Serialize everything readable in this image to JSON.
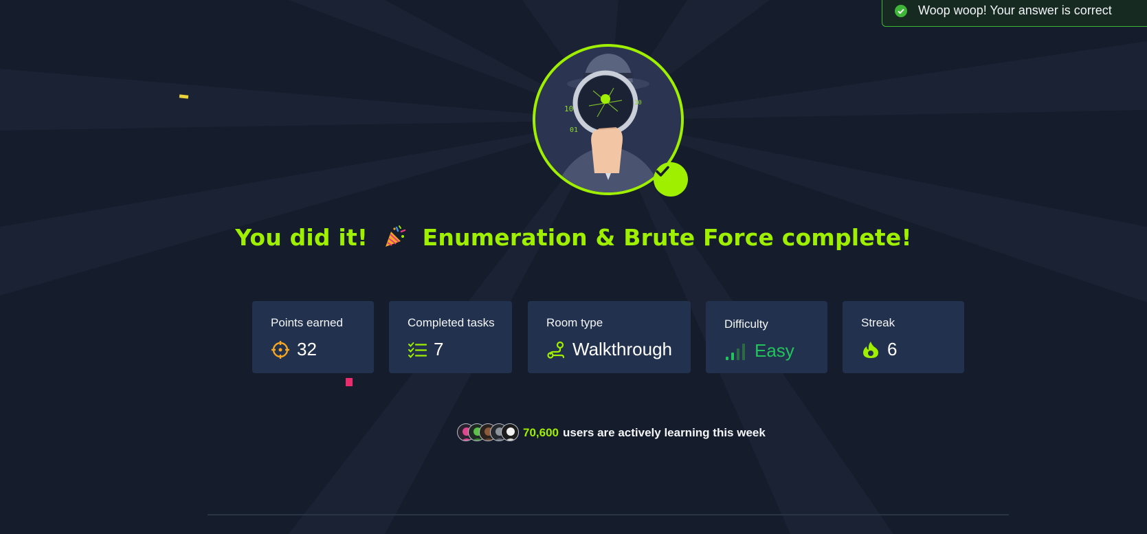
{
  "toast": {
    "message": "Woop woop! Your answer is correct",
    "color": "#3fb638"
  },
  "headline": {
    "before": "You did it!",
    "emoji": "party-popper",
    "after": "Enumeration & Brute Force complete!",
    "color": "#9fef00"
  },
  "stats": [
    {
      "label": "Points earned",
      "icon": "crosshair-icon",
      "value": "32"
    },
    {
      "label": "Completed tasks",
      "icon": "checklist-icon",
      "value": "7"
    },
    {
      "label": "Room type",
      "icon": "route-icon",
      "value": "Walkthrough"
    },
    {
      "label": "Difficulty",
      "icon": "signal-bars-icon",
      "value": "Easy"
    },
    {
      "label": "Streak",
      "icon": "flame-icon",
      "value": "6"
    }
  ],
  "community": {
    "count": "70,600",
    "text": "users are actively learning this week",
    "avatars": [
      "avatar-pink",
      "avatar-green",
      "avatar-brown",
      "avatar-gray",
      "avatar-white"
    ]
  },
  "colors": {
    "background": "#151c2b",
    "card": "#22314d",
    "accent": "#9fef00",
    "easy": "#22c35c",
    "points": "#f5a623"
  }
}
